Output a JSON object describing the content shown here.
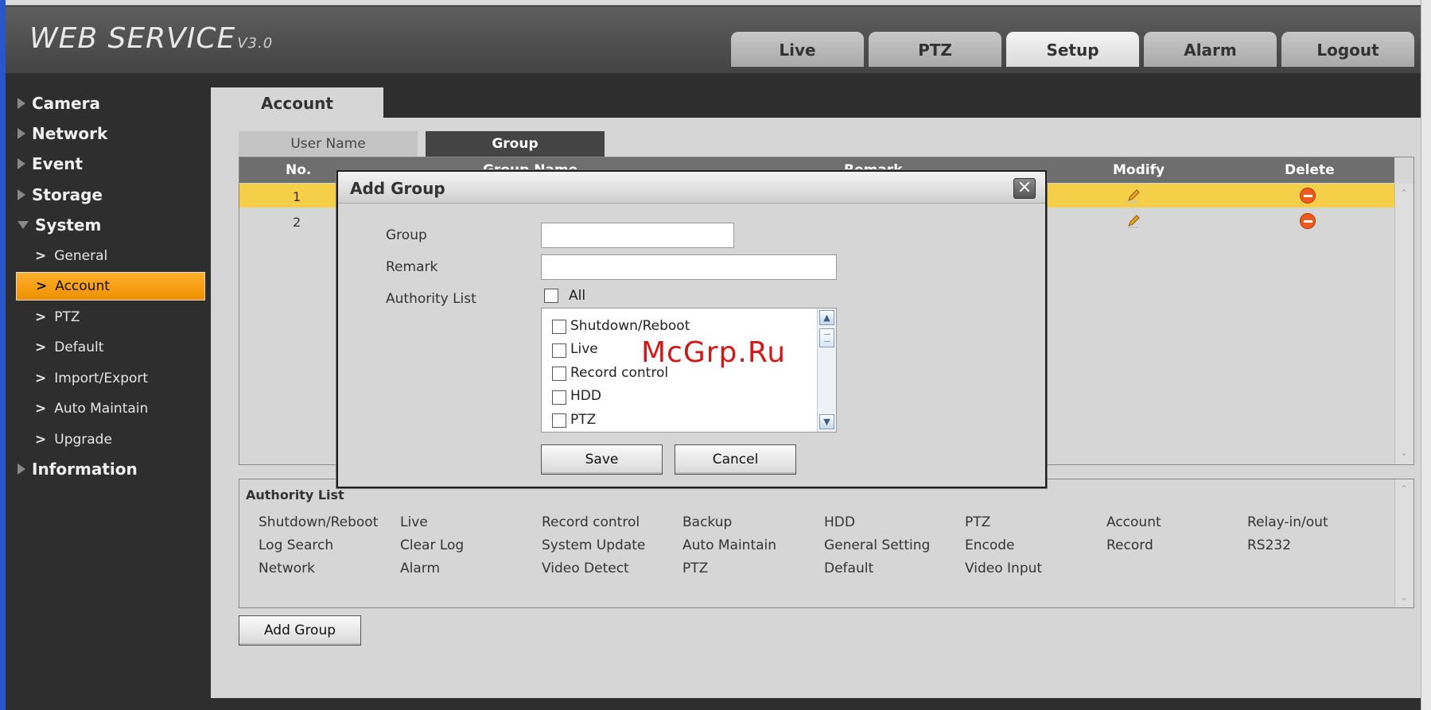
{
  "header": {
    "logo": "WEB  SERVICE",
    "version": "V3.0",
    "tabs": [
      "Live",
      "PTZ",
      "Setup",
      "Alarm",
      "Logout"
    ]
  },
  "sidebar": {
    "groups": {
      "camera": "Camera",
      "network": "Network",
      "event": "Event",
      "storage": "Storage",
      "system": "System",
      "information": "Information"
    },
    "system_items": [
      "General",
      "Account",
      "PTZ",
      "Default",
      "Import/Export",
      "Auto Maintain",
      "Upgrade"
    ],
    "active_item": "Account"
  },
  "page": {
    "title_tab": "Account",
    "subtabs": {
      "user": "User Name",
      "group": "Group"
    }
  },
  "grid": {
    "headers": {
      "no": "No.",
      "group_name": "Group Name",
      "remark": "Remark",
      "modify": "Modify",
      "delete": "Delete"
    },
    "rows": [
      {
        "no": "1",
        "selected": true
      },
      {
        "no": "2",
        "selected": false
      }
    ]
  },
  "authority": {
    "title": "Authority List",
    "rows": [
      [
        "Shutdown/Reboot",
        "Live",
        "Record control",
        "Backup",
        "HDD",
        "PTZ",
        "Account",
        "Relay-in/out"
      ],
      [
        "Log Search",
        "Clear Log",
        "System Update",
        "Auto Maintain",
        "General Setting",
        "Encode",
        "Record",
        "RS232"
      ],
      [
        "Network",
        "Alarm",
        "Video Detect",
        "PTZ",
        "Default",
        "Video Input"
      ]
    ]
  },
  "buttons": {
    "add_group": "Add Group"
  },
  "modal": {
    "title": "Add Group",
    "close": "×",
    "group_label": "Group",
    "group_value": "",
    "remark_label": "Remark",
    "remark_value": "",
    "authority_label": "Authority List",
    "all_label": "All",
    "list_items": [
      "Shutdown/Reboot",
      "Live",
      "Record control",
      "HDD",
      "PTZ"
    ],
    "save": "Save",
    "cancel": "Cancel"
  },
  "watermark": "McGrp.Ru",
  "colors": {
    "accent": "#f5a31b",
    "selected_row": "#f5cf48",
    "delete_icon": "#ef5a1f"
  }
}
